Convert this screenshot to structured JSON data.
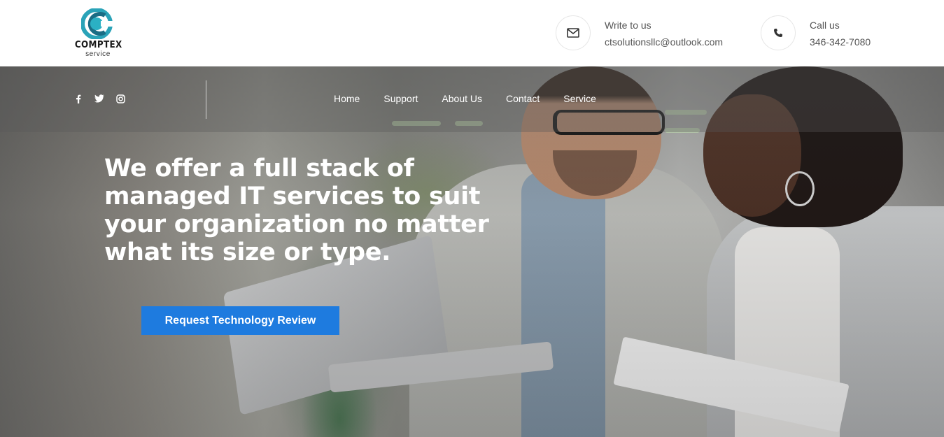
{
  "brand": {
    "name": "COMPTEX",
    "tagline": "service"
  },
  "contacts": {
    "email": {
      "label": "Write to us",
      "value": "ctsolutionsllc@outlook.com",
      "icon": "envelope-icon"
    },
    "phone": {
      "label": "Call us",
      "value": "346-342-7080",
      "icon": "phone-icon"
    }
  },
  "social": [
    {
      "icon": "facebook-icon"
    },
    {
      "icon": "twitter-icon"
    },
    {
      "icon": "instagram-icon"
    }
  ],
  "nav": {
    "items": [
      {
        "label": "Home"
      },
      {
        "label": "Support"
      },
      {
        "label": "About Us"
      },
      {
        "label": "Contact"
      },
      {
        "label": "Service"
      }
    ]
  },
  "hero": {
    "headline": "We offer a full stack of managed IT services to suit your organization no matter what its size or type.",
    "cta_label": "Request Technology Review"
  },
  "colors": {
    "accent": "#1e7bdf",
    "logo_teal": "#2aa3b8",
    "text_muted": "#555555"
  }
}
